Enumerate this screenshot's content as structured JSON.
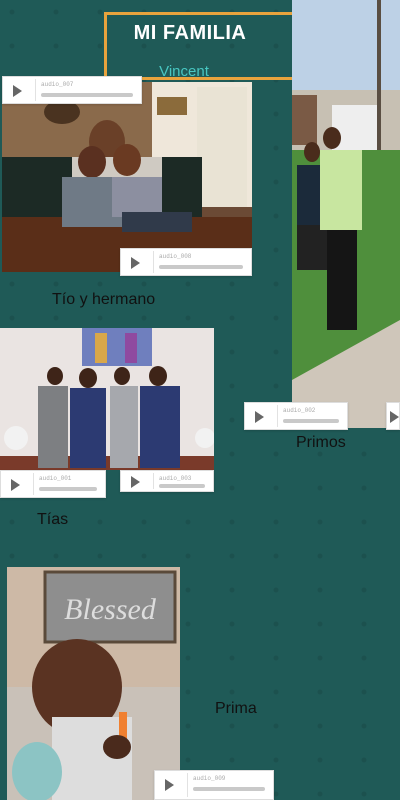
{
  "header": {
    "title": "MI FAMILIA",
    "subtitle": "Vincent"
  },
  "captions": {
    "tio_hermano": "Tío y hermano",
    "primos": "Primos",
    "tias": "Tías",
    "prima": "Prima"
  },
  "photo_text": {
    "blessed_sign": "Blessed"
  },
  "audio_players": [
    {
      "name": "audio_007"
    },
    {
      "name": "audio_008"
    },
    {
      "name": "audio_002"
    },
    {
      "name": "audio_001"
    },
    {
      "name": "audio_003"
    },
    {
      "name": "audio_009"
    }
  ],
  "colors": {
    "background": "#1f5a57",
    "accent": "#e8a33d",
    "subtitle": "#47c6c1"
  }
}
